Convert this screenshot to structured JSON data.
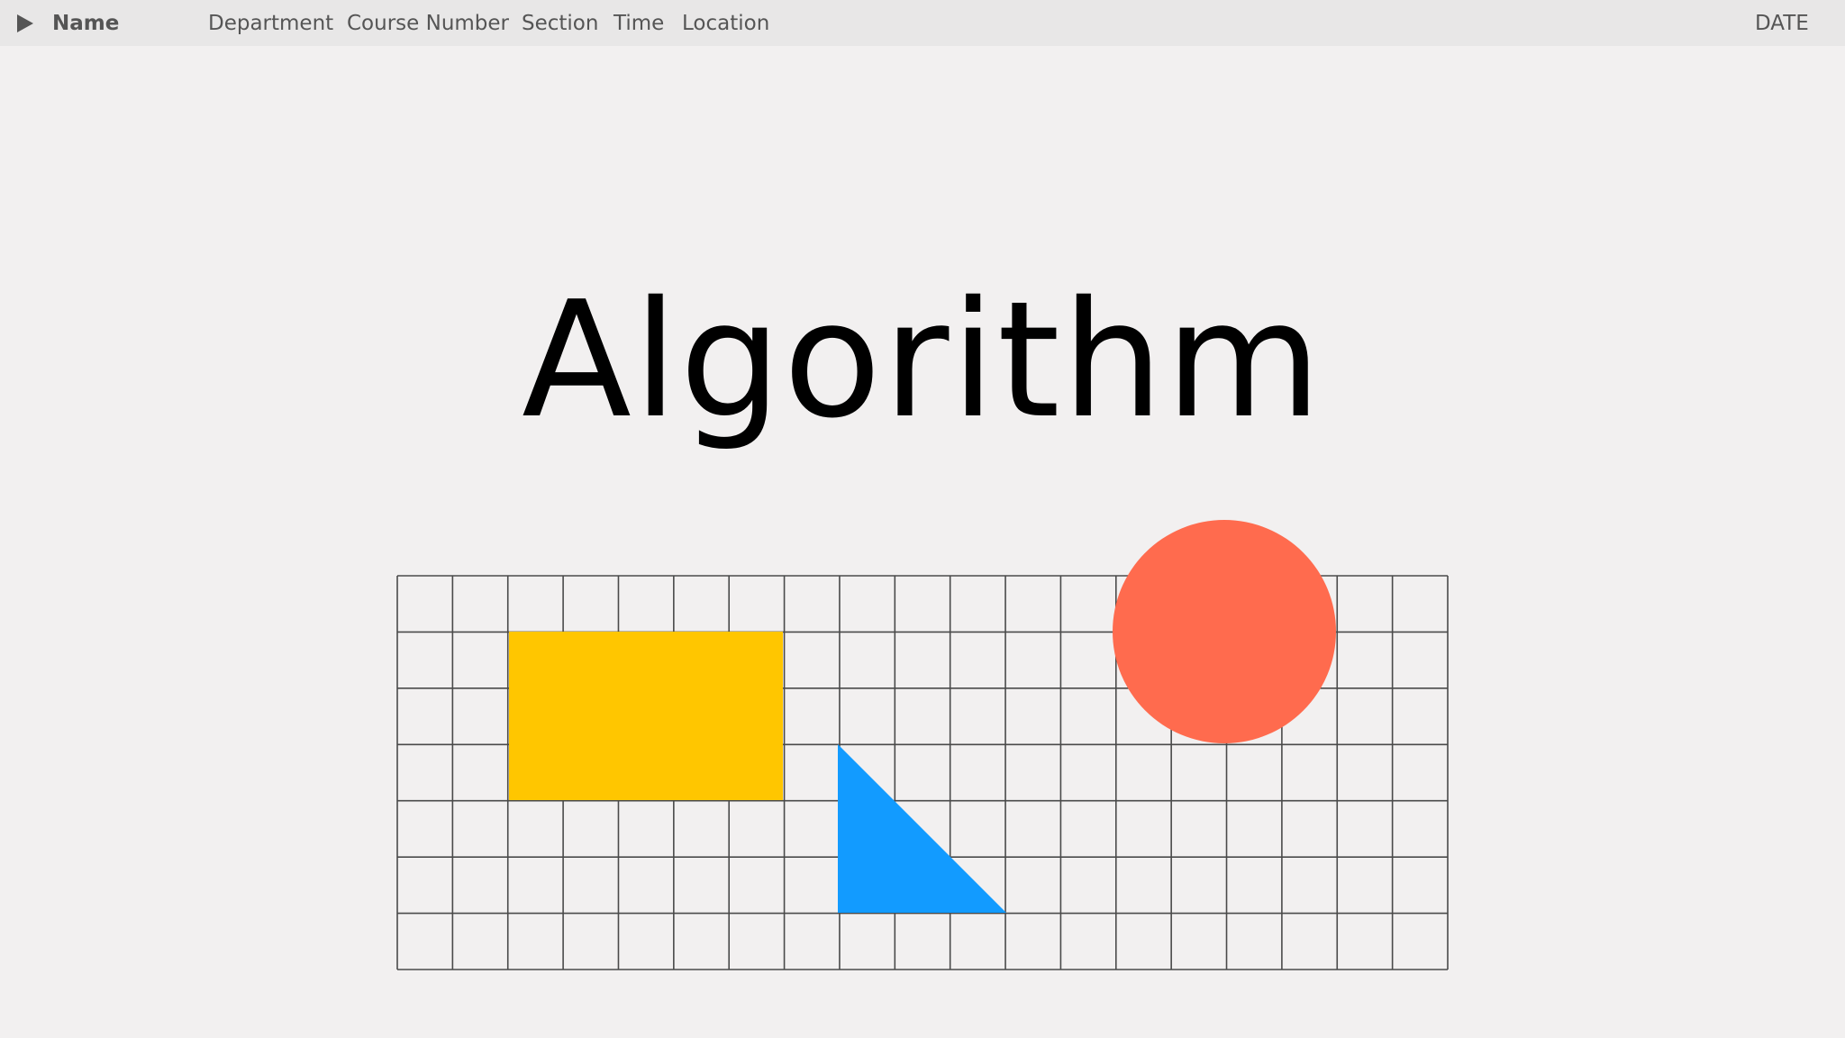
{
  "header": {
    "name_label": "Name",
    "department_label": "Department",
    "course_number_label": "Course Number",
    "section_label": "Section",
    "time_label": "Time",
    "location_label": "Location",
    "date_label": "DATE"
  },
  "slide": {
    "title": "Algorithm"
  },
  "colors": {
    "rectangle": "#FFC600",
    "triangle": "#129BFF",
    "circle": "#FF6B4E",
    "grid_line": "#4a4a4a",
    "background": "#f2f0f0"
  },
  "grid": {
    "columns": 19,
    "rows": 7
  }
}
